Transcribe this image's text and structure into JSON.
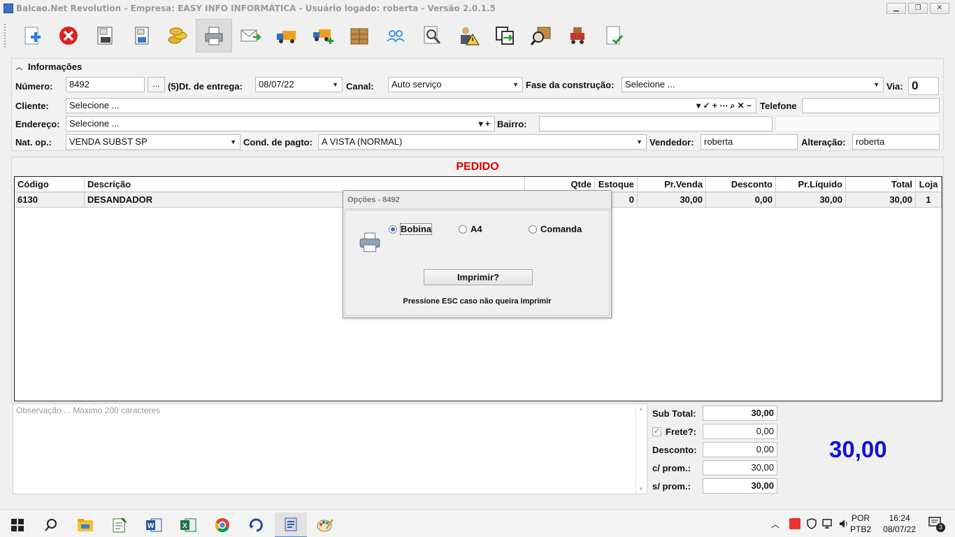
{
  "window": {
    "title": "Balcao.Net Revolution - Empresa: EASY INFO INFORMÁTICA - Usuário logado: roberta - Versão 2.0.1.5"
  },
  "toolbar": {
    "buttons": [
      {
        "name": "new-document",
        "icon": "new-doc-icon"
      },
      {
        "name": "cancel",
        "icon": "cancel-icon"
      },
      {
        "name": "save",
        "icon": "save-icon"
      },
      {
        "name": "save-as",
        "icon": "save-as-icon"
      },
      {
        "name": "payment",
        "icon": "coins-icon"
      },
      {
        "name": "print",
        "icon": "printer-icon"
      },
      {
        "name": "email",
        "icon": "email-icon"
      },
      {
        "name": "delivery",
        "icon": "truck-icon"
      },
      {
        "name": "add-delivery",
        "icon": "truck-add-icon"
      },
      {
        "name": "boxes",
        "icon": "boxes-icon"
      },
      {
        "name": "users-sync",
        "icon": "users-sync-icon"
      },
      {
        "name": "search-document",
        "icon": "search-doc-icon"
      },
      {
        "name": "user-warning",
        "icon": "user-warning-icon"
      },
      {
        "name": "transfer",
        "icon": "transfer-icon"
      },
      {
        "name": "search-box",
        "icon": "search-box-icon"
      },
      {
        "name": "cart",
        "icon": "cart-icon"
      },
      {
        "name": "confirm-document",
        "icon": "doc-check-icon"
      }
    ]
  },
  "info": {
    "header": "Informações",
    "numero_label": "Número:",
    "numero_value": "8492",
    "ellipsis_label": "...",
    "dt_entrega_label": "(5)Dt. de entrega:",
    "dt_entrega_value": "08/07/22",
    "canal_label": "Canal:",
    "canal_value": "Auto serviço",
    "fase_label": "Fase da construção:",
    "fase_value": "Selecione ...",
    "via_label": "Via:",
    "via_value": "0",
    "cliente_label": "Cliente:",
    "cliente_value": "Selecione ...",
    "cliente_tools": "▾ ✓ + ⋯ ⌕ ✕ −",
    "telefone_label": "Telefone",
    "telefone_value": "",
    "endereco_label": "Endereço:",
    "endereco_value": "Selecione ...",
    "endereco_tools": "▾ +",
    "bairro_label": "Bairro:",
    "bairro_value": "",
    "natop_label": "Nat. op.:",
    "natop_value": "VENDA SUBST SP",
    "cond_label": "Cond. de pagto:",
    "cond_value": "A VISTA (NORMAL)",
    "vendedor_label": "Vendedor:",
    "vendedor_value": "roberta",
    "alteracao_label": "Alteração:",
    "alteracao_value": "roberta"
  },
  "pedido": {
    "title": "PEDIDO",
    "columns": [
      "Código",
      "Descrição",
      "Qtde",
      "Estoque",
      "Pr.Venda",
      "Desconto",
      "Pr.Líquido",
      "Total",
      "Loja"
    ],
    "rows": [
      [
        "6130",
        "DESANDADOR",
        "",
        "0",
        "30,00",
        "0,00",
        "30,00",
        "30,00",
        "1"
      ]
    ]
  },
  "obs": {
    "placeholder": "Observação ... Máximo 200 caracteres"
  },
  "totals": {
    "subtotal_label": "Sub Total:",
    "subtotal_value": "30,00",
    "frete_label": "Frete?:",
    "frete_value": "0,00",
    "desconto_label": "Desconto:",
    "desconto_value": "0,00",
    "cprom_label": "c/ prom.:",
    "cprom_value": "30,00",
    "sprom_label": "s/ prom.:",
    "sprom_value": "30,00",
    "grand_total": "30,00"
  },
  "dialog": {
    "title": "Opções - 8492",
    "options": [
      "Bobina",
      "A4",
      "Comanda"
    ],
    "selected": "Bobina",
    "print_button": "Imprimir?",
    "hint": "Pressione ESC caso não queira imprimir"
  },
  "taskbar": {
    "lang_line1": "POR",
    "lang_line2": "PTB2",
    "time": "16:24",
    "date": "08/07/22",
    "notifications": "3"
  },
  "colors": {
    "pedido_title": "#e00000",
    "grand_total": "#1010d8",
    "accent": "#3a6fc4"
  }
}
